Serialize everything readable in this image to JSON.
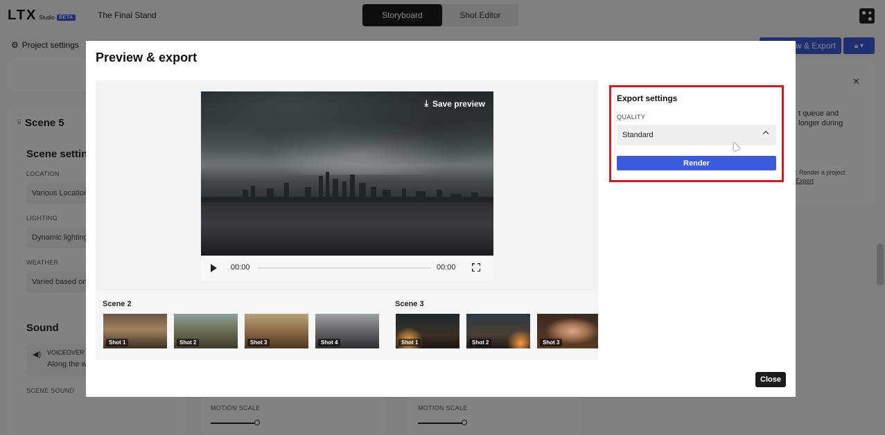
{
  "app": {
    "logo_text": "LTX",
    "logo_sub": "Studio",
    "beta_badge": "BETA",
    "project_title": "The Final Stand",
    "mode_tabs": [
      {
        "label": "Storyboard",
        "active": true
      },
      {
        "label": "Shot Editor",
        "active": false
      }
    ],
    "project_settings_label": "Project settings",
    "export_button_label": "Preview & Export"
  },
  "background": {
    "scene_title": "Scene 5",
    "scene_settings_heading": "Scene settings",
    "location_label": "LOCATION",
    "location_value": "Various Locations",
    "lighting_label": "LIGHTING",
    "lighting_value": "Dynamic lighting",
    "weather_label": "WEATHER",
    "weather_value": "Varied based on",
    "sound_heading": "Sound",
    "voiceover_label": "VOICEOVER",
    "voiceover_text": "Along the wa",
    "scene_sound_label": "SCENE SOUND",
    "motion_scale_label": "MOTION SCALE",
    "right_panel_line1": "t queue and",
    "right_panel_line2": "longer during",
    "right_panel_hint": ": Render a project",
    "right_panel_link": "Export"
  },
  "modal": {
    "title": "Preview & export",
    "save_preview_label": "Save preview",
    "time_current": "00:00",
    "time_total": "00:00",
    "scenes": [
      {
        "label": "Scene 2",
        "shots": [
          "Shot 1",
          "Shot 2",
          "Shot 3",
          "Shot 4"
        ]
      },
      {
        "label": "Scene 3",
        "shots": [
          "Shot 1",
          "Shot 2",
          "Shot 3"
        ]
      }
    ],
    "export_settings": {
      "title": "Export settings",
      "quality_label": "QUALITY",
      "quality_value": "Standard",
      "render_label": "Render"
    },
    "close_label": "Close"
  },
  "colors": {
    "accent_blue": "#3a5be0",
    "highlight_red": "#e0141c",
    "dark": "#1c1c1c"
  }
}
